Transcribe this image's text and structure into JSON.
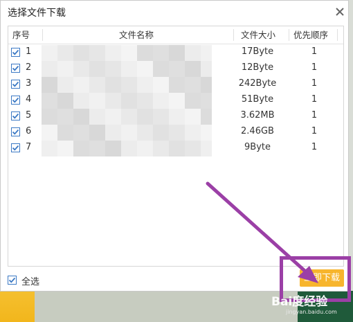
{
  "dialog": {
    "title": "选择文件下载",
    "close_icon": "close-icon"
  },
  "table": {
    "columns": [
      "序号",
      "文件名称",
      "文件大小",
      "优先顺序"
    ],
    "rows": [
      {
        "index": "1",
        "checked": true,
        "size": "17Byte",
        "priority": "1"
      },
      {
        "index": "2",
        "checked": true,
        "size": "12Byte",
        "priority": "1"
      },
      {
        "index": "3",
        "checked": true,
        "size": "242Byte",
        "priority": "1"
      },
      {
        "index": "4",
        "checked": true,
        "size": "51Byte",
        "priority": "1"
      },
      {
        "index": "5",
        "checked": true,
        "size": "3.62MB",
        "priority": "1"
      },
      {
        "index": "6",
        "checked": true,
        "size": "2.46GB",
        "priority": "1"
      },
      {
        "index": "7",
        "checked": true,
        "size": "9Byte",
        "priority": "1"
      }
    ]
  },
  "footer": {
    "select_all_label": "全选",
    "select_all_checked": true,
    "download_button": "立即下载"
  },
  "watermark": {
    "text": "Bai度经验",
    "sub": "jingyan.baidu.com"
  },
  "colors": {
    "accent": "#f7b52d",
    "checkbox": "#3a78c4",
    "annotation": "#9b3fa6"
  }
}
